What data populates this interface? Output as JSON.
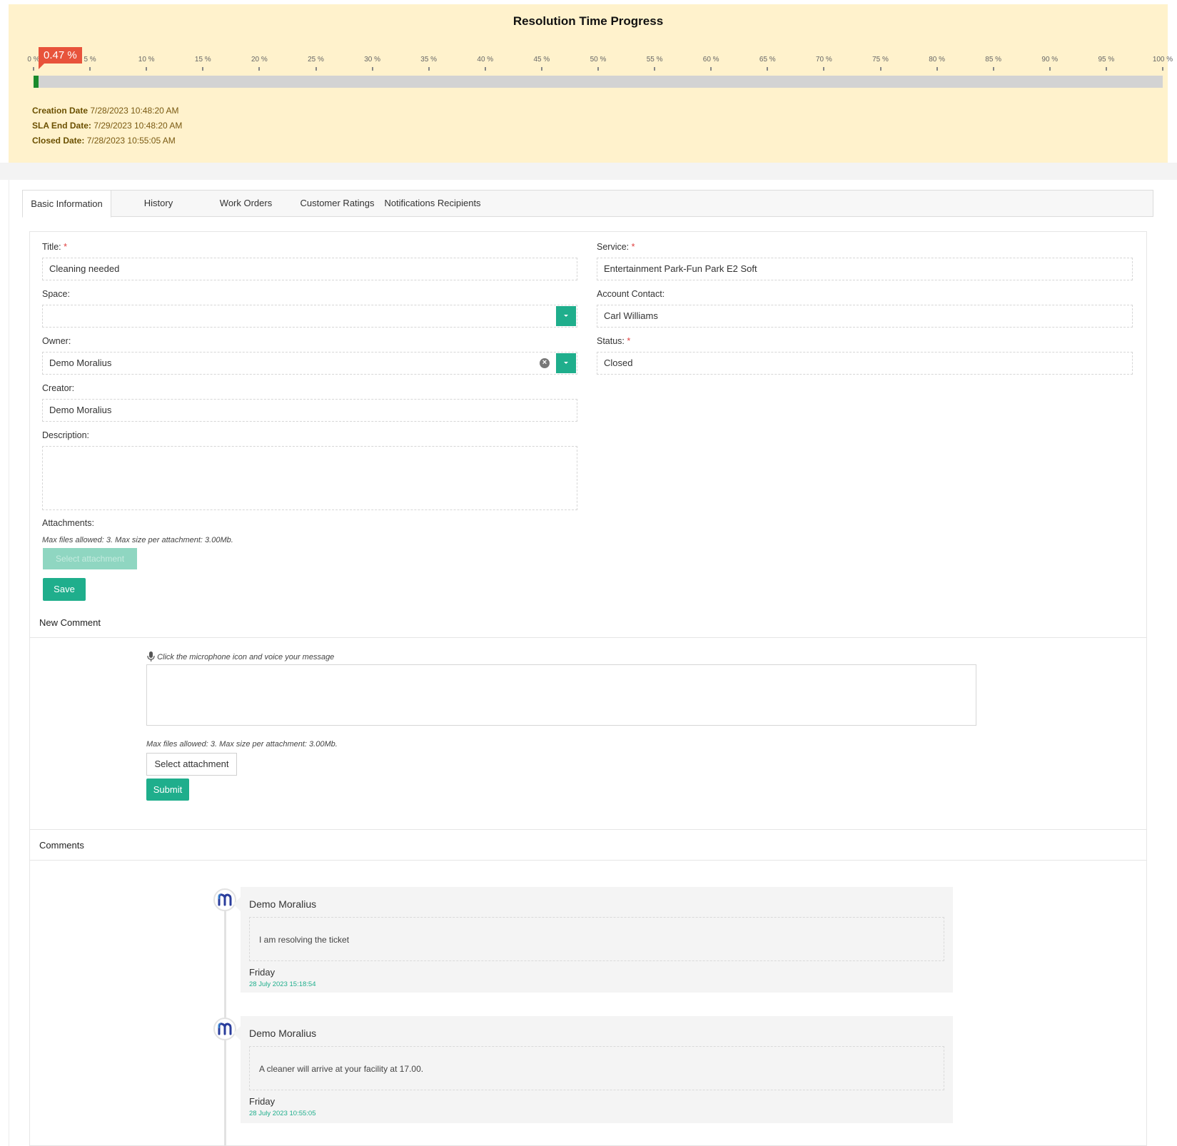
{
  "progress": {
    "title": "Resolution Time Progress",
    "percent_label": "0.47 %",
    "percent_value": 0.47,
    "ticks": [
      "0 %",
      "5 %",
      "10 %",
      "15 %",
      "20 %",
      "25 %",
      "30 %",
      "35 %",
      "40 %",
      "45 %",
      "50 %",
      "55 %",
      "60 %",
      "65 %",
      "70 %",
      "75 %",
      "80 %",
      "85 %",
      "90 %",
      "95 %",
      "100 %"
    ],
    "creation_label": "Creation Date",
    "creation_value": "7/28/2023 10:48:20 AM",
    "sla_label": "SLA End Date:",
    "sla_value": "7/29/2023 10:48:20 AM",
    "closed_label": "Closed Date:",
    "closed_value": "7/28/2023 10:55:05 AM",
    "fill_color": "#1a8a2b",
    "bubble_color": "#e8533b"
  },
  "tabs": [
    "Basic Information",
    "History",
    "Work Orders",
    "Customer Ratings",
    "Notifications Recipients"
  ],
  "form": {
    "title_label": "Title:",
    "title_value": "Cleaning needed",
    "space_label": "Space:",
    "space_value": "",
    "owner_label": "Owner:",
    "owner_value": "Demo Moralius",
    "creator_label": "Creator:",
    "creator_value": "Demo Moralius",
    "description_label": "Description:",
    "attachments_label": "Attachments:",
    "attachments_hint": "Max files allowed: 3. Max size per attachment: 3.00Mb.",
    "select_attachment": "Select attachment",
    "save_label": "Save",
    "service_label": "Service:",
    "service_value": "Entertainment Park-Fun Park E2 Soft",
    "account_contact_label": "Account Contact:",
    "account_contact_value": "Carl Williams",
    "status_label": "Status:",
    "status_value": "Closed",
    "required_mark": "*"
  },
  "new_comment": {
    "title": "New Comment",
    "mic_hint": "Click the microphone icon and voice your message",
    "files_hint": "Max files allowed: 3. Max size per attachment: 3.00Mb.",
    "select_attachment": "Select attachment",
    "submit_label": "Submit"
  },
  "comments": {
    "title": "Comments",
    "items": [
      {
        "author": "Demo Moralius",
        "text": "I am resolving the ticket",
        "day": "Friday",
        "date": "28 July 2023 15:18:54"
      },
      {
        "author": "Demo Moralius",
        "text": "A cleaner will arrive at your facility at 17.00.",
        "day": "Friday",
        "date": "28 July 2023 10:55:05"
      }
    ]
  },
  "accent_color": "#1fae8c"
}
